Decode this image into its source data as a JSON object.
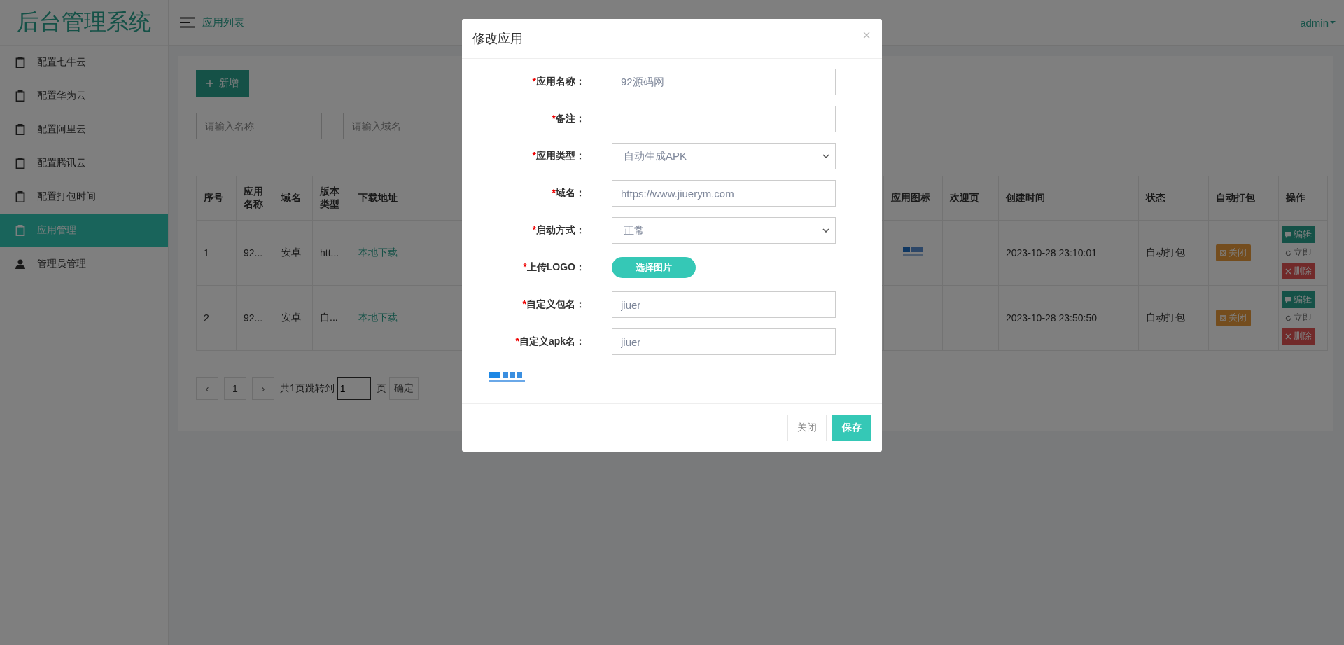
{
  "app": {
    "logo": "后台管理系统",
    "breadcrumb": "应用列表",
    "user": "admin"
  },
  "sidebar": {
    "items": [
      {
        "label": "配置七牛云",
        "kind": "config",
        "selected": false
      },
      {
        "label": "配置华为云",
        "kind": "config",
        "selected": false
      },
      {
        "label": "配置阿里云",
        "kind": "config",
        "selected": false
      },
      {
        "label": "配置腾讯云",
        "kind": "config",
        "selected": false
      },
      {
        "label": "配置打包时间",
        "kind": "config",
        "selected": false
      },
      {
        "label": "应用管理",
        "kind": "config",
        "selected": true
      },
      {
        "label": "管理员管理",
        "kind": "admin",
        "selected": false
      }
    ]
  },
  "toolbar": {
    "add_button": "新增",
    "filters": [
      {
        "placeholder": "请输入名称"
      },
      {
        "placeholder": "请输入域名"
      }
    ]
  },
  "table": {
    "columns": [
      {
        "label": "序号"
      },
      {
        "label": "应用名称"
      },
      {
        "label": "域名"
      },
      {
        "label": "版本类型"
      },
      {
        "label": "下载地址"
      },
      {
        "label": "应用图标"
      },
      {
        "label": "欢迎页"
      },
      {
        "label": "创建时间"
      },
      {
        "label": "状态"
      },
      {
        "label": "自动打包"
      },
      {
        "label": "操作"
      }
    ],
    "rows": [
      {
        "index": "1",
        "name": "92...",
        "platform": "安卓",
        "version_type": "htt...",
        "download": "本地下载",
        "created": "2023-10-28 23:10:01",
        "status": "自动打包",
        "auto_pack": "关闭",
        "actions": [
          {
            "kind": "edit",
            "label": "编辑"
          },
          {
            "kind": "build",
            "label": "立即"
          },
          {
            "kind": "delete",
            "label": "删除"
          }
        ]
      },
      {
        "index": "2",
        "name": "92...",
        "platform": "安卓",
        "version_type": "自...",
        "download": "本地下载",
        "created": "2023-10-28 23:50:50",
        "status": "自动打包",
        "auto_pack": "关闭",
        "actions": [
          {
            "kind": "edit",
            "label": "编辑"
          },
          {
            "kind": "build",
            "label": "立即"
          },
          {
            "kind": "delete",
            "label": "删除"
          }
        ]
      }
    ]
  },
  "pagination": {
    "prev": "‹",
    "pages": [
      {
        "label": "1",
        "selected": true
      }
    ],
    "next": "›",
    "total": "共1页跳转到",
    "jump_value": "1",
    "unit": "页",
    "confirm": "确定"
  },
  "modal": {
    "title": "修改应用",
    "close": "×",
    "fields": [
      {
        "kind": "input",
        "required_mark": "*",
        "label": "应用名称：",
        "value": "92源码网"
      },
      {
        "kind": "input",
        "required_mark": "*",
        "label": "备注："
      },
      {
        "kind": "select",
        "required_mark": "*",
        "label": "应用类型：",
        "value": "自动生成APK"
      },
      {
        "kind": "input",
        "required_mark": "*",
        "label": "域名：",
        "value": "https://www.jiuerym.com"
      },
      {
        "kind": "select",
        "required_mark": "*",
        "label": "启动方式：",
        "value": "正常"
      },
      {
        "kind": "upload",
        "required_mark": "*",
        "label": "上传LOGO：",
        "button": "选择图片"
      },
      {
        "kind": "input",
        "required_mark": "*",
        "label": "自定义包名：",
        "value": "jiuer"
      },
      {
        "kind": "input",
        "required_mark": "*",
        "label": "自定义apk名：",
        "value": "jiuer"
      }
    ],
    "buttons": [
      {
        "kind": "default",
        "label": "关闭"
      },
      {
        "kind": "primary",
        "label": "保存"
      }
    ]
  }
}
